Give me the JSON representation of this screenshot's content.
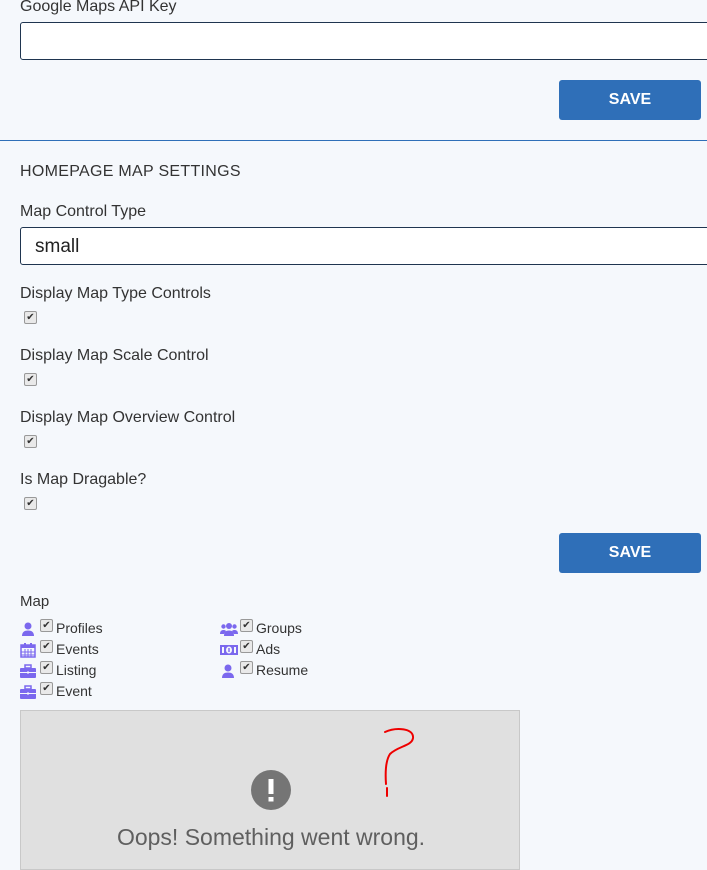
{
  "api_key": {
    "label": "Google Maps API Key",
    "value": "",
    "save_label": "SAVE"
  },
  "homepage_map": {
    "heading": "HOMEPAGE MAP SETTINGS",
    "control_type_label": "Map Control Type",
    "control_type_value": "small",
    "checkboxes": [
      {
        "label": "Display Map Type Controls",
        "checked": true
      },
      {
        "label": "Display Map Scale Control",
        "checked": true
      },
      {
        "label": "Display Map Overview Control",
        "checked": true
      },
      {
        "label": "Is Map Dragable?",
        "checked": true
      }
    ],
    "save_label": "SAVE"
  },
  "map": {
    "label": "Map",
    "layers": [
      {
        "label": "Profiles",
        "icon": "user-icon",
        "checked": true
      },
      {
        "label": "Events",
        "icon": "calendar-icon",
        "checked": true
      },
      {
        "label": "Listing",
        "icon": "briefcase-icon",
        "checked": true
      },
      {
        "label": "Event",
        "icon": "briefcase-icon",
        "checked": true
      },
      {
        "label": "Groups",
        "icon": "users-icon",
        "checked": true
      },
      {
        "label": "Ads",
        "icon": "money-icon",
        "checked": true
      },
      {
        "label": "Resume",
        "icon": "user-icon",
        "checked": true
      }
    ],
    "error_message": "Oops! Something went wrong.",
    "icon_color": "#7b68ee"
  }
}
